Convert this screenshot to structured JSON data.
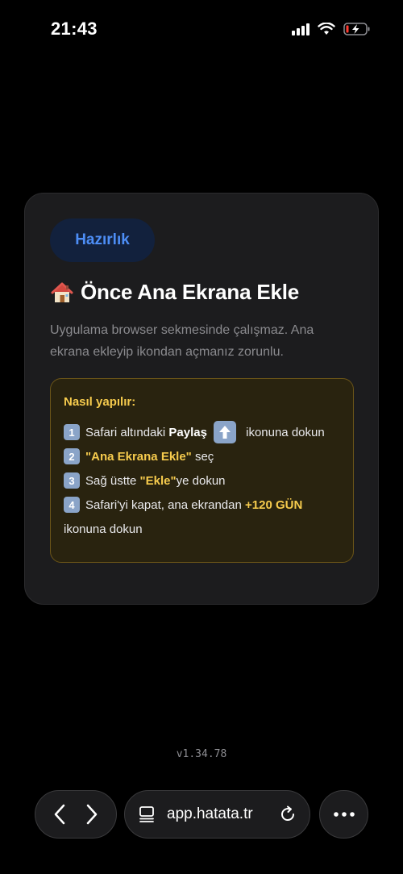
{
  "status": {
    "time": "21:43"
  },
  "card": {
    "badge": "Hazırlık",
    "title": "Önce Ana Ekrana Ekle",
    "description": "Uygulama browser sekmesinde çalışmaz. Ana ekrana ekleyip ikondan açmanız zorunlu.",
    "howto": {
      "title": "Nasıl yapılır:",
      "step1": {
        "num": "1",
        "pre": "Safari altındaki ",
        "bold": "Paylaş",
        "post": " ikonuna dokun"
      },
      "step2": {
        "num": "2",
        "bold": "\"Ana Ekrana Ekle\"",
        "post": " seç"
      },
      "step3": {
        "num": "3",
        "pre": "Sağ üstte ",
        "bold": "\"Ekle\"",
        "post": "ye dokun"
      },
      "step4": {
        "num": "4",
        "pre": "Safari'yi kapat, ana ekrandan ",
        "bold": "+120 GÜN",
        "cont": "ikonuna dokun"
      }
    }
  },
  "version": "v1.34.78",
  "browser": {
    "url": "app.hatata.tr"
  },
  "colors": {
    "accent_blue": "#4d8ef6",
    "accent_yellow": "#f6cb4d",
    "background": "#000000",
    "card": "#1c1c1e"
  },
  "icons": [
    "house-icon",
    "share-icon",
    "back-icon",
    "forward-icon",
    "tabs-icon",
    "reload-icon",
    "more-icon",
    "signal-icon",
    "wifi-icon",
    "battery-charging-icon"
  ]
}
